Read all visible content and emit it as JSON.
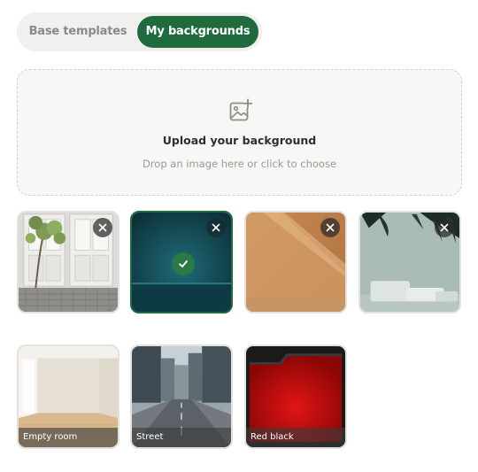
{
  "tabs": {
    "base_label": "Base templates",
    "mine_label": "My backgrounds",
    "active": "My backgrounds"
  },
  "upload": {
    "icon": "image-plus-icon",
    "title": "Upload your background",
    "subtitle": "Drop an image here or click to choose"
  },
  "my_backgrounds": [
    {
      "name": "vintage-doors",
      "selected": false,
      "removable": true
    },
    {
      "name": "teal-stage",
      "selected": true,
      "removable": true
    },
    {
      "name": "warm-wall",
      "selected": false,
      "removable": true
    },
    {
      "name": "palm-podium",
      "selected": false,
      "removable": true
    }
  ],
  "templates": [
    {
      "label": "Empty room"
    },
    {
      "label": "Street"
    },
    {
      "label": "Red black"
    }
  ],
  "colors": {
    "accent": "#1f6b3e",
    "tab_bg": "#f1f0ee",
    "upload_bg": "#f8f7f5"
  }
}
